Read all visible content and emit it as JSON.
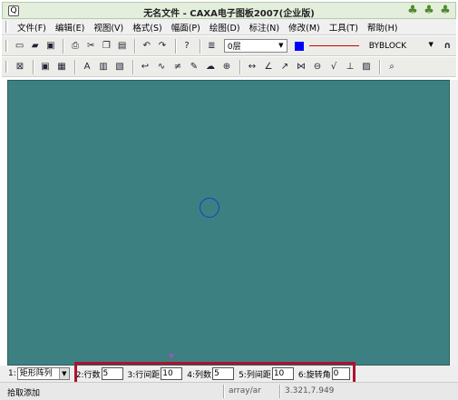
{
  "window": {
    "title": "无名文件 - CAXA电子图板2007(企业版)",
    "app_icon": "Q"
  },
  "menu": [
    {
      "label": "文件(F)"
    },
    {
      "label": "编辑(E)"
    },
    {
      "label": "视图(V)"
    },
    {
      "label": "格式(S)"
    },
    {
      "label": "幅面(P)"
    },
    {
      "label": "绘图(D)"
    },
    {
      "label": "标注(N)"
    },
    {
      "label": "修改(M)"
    },
    {
      "label": "工具(T)"
    },
    {
      "label": "帮助(H)"
    }
  ],
  "toolbar1": {
    "layer_value": "0层",
    "line_style_value": "BYBLOCK",
    "color_value": "#0000ff",
    "icons": [
      "new-file-icon",
      "open-folder-icon",
      "save-icon",
      "print-icon",
      "cut-icon",
      "copy-icon",
      "paste-icon",
      "undo-icon",
      "redo-icon",
      "help-icon",
      "layer-icon"
    ]
  },
  "toolbar2": {
    "icons": [
      "zoom-window-icon",
      "zoom-all-icon",
      "zoom-dynamic-icon",
      "text-icon",
      "table-icon",
      "image-icon",
      "arc-tool-icon",
      "wave-line-icon",
      "break-line-icon",
      "pen-icon",
      "cloud-icon",
      "block-icon",
      "dimension-icon",
      "angle-dim-icon",
      "leader-icon",
      "weld-icon",
      "tolerance-icon",
      "roughness-icon",
      "datum-icon",
      "hatch-icon",
      "inspect-icon"
    ]
  },
  "command": {
    "mode_number": "1:",
    "mode": "矩形阵列",
    "fields": [
      {
        "label": "2:行数",
        "value": "5"
      },
      {
        "label": "3:行间距",
        "value": "10"
      },
      {
        "label": "4:列数",
        "value": "5"
      },
      {
        "label": "5:列间距",
        "value": "10"
      },
      {
        "label": "6:旋转角",
        "value": "0"
      }
    ]
  },
  "status": {
    "prompt": "拾取添加",
    "command_name": "array/ar",
    "coordinates": "3.321,7.949"
  },
  "colors": {
    "canvas": "#3d8081",
    "highlight_box": "#b01030",
    "titlebar": "#e4eedc"
  }
}
